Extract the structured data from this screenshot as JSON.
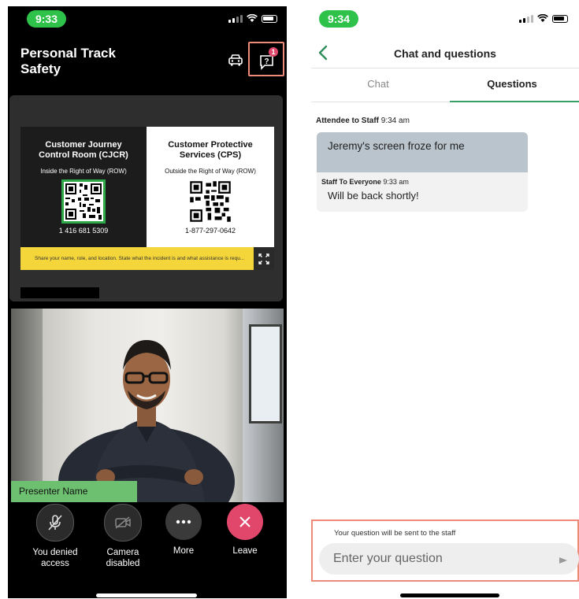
{
  "left": {
    "status": {
      "time": "9:33"
    },
    "session_title": "Personal Track Safety",
    "questions_badge": "1",
    "slide": {
      "cjcr_heading": "Customer Journey Control Room (CJCR)",
      "cjcr_sub": "Inside the Right of Way (ROW)",
      "cjcr_phone": "1 416 681 5309",
      "cps_heading": "Customer Protective Services (CPS)",
      "cps_sub": "Outside the Right of Way (ROW)",
      "cps_phone": "1-877-297-0642",
      "footer": "Share your name, role, and location. State what the incident is and what assistance is requ..."
    },
    "presenter_name": "Presenter Name",
    "controls": {
      "mic_label": "You denied access",
      "camera_label": "Camera disabled",
      "more_label": "More",
      "leave_label": "Leave"
    }
  },
  "right": {
    "status": {
      "time": "9:34"
    },
    "title": "Chat and questions",
    "tabs": {
      "chat": "Chat",
      "questions": "Questions"
    },
    "message": {
      "sender": "Attendee to Staff",
      "time": "9:34 am",
      "text": "Jeremy's screen froze for me",
      "reply_sender": "Staff To Everyone",
      "reply_time": "9:33 am",
      "reply_text": "Will be back shortly!"
    },
    "input": {
      "hint": "Your question will be sent to the staff",
      "placeholder": "Enter your question"
    }
  },
  "colors": {
    "status_green": "#2ec24b",
    "highlight_border": "#f08a78",
    "leave_red": "#e0476b",
    "tab_underline": "#3aa068",
    "presenter_label_bg": "#6dc070"
  }
}
